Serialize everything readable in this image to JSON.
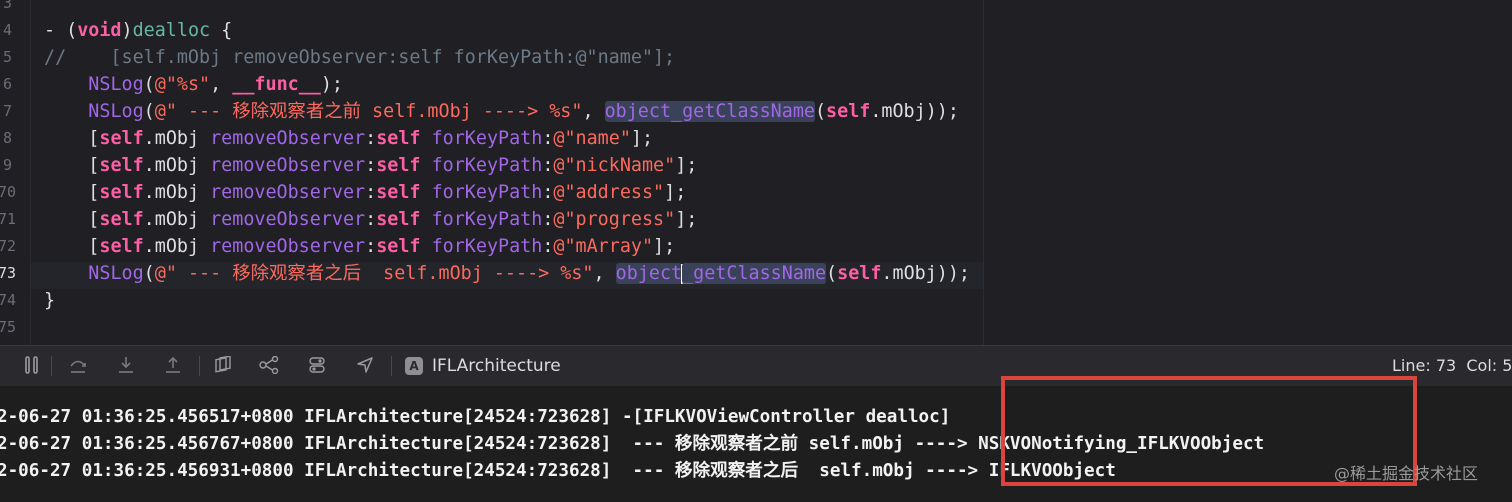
{
  "editor": {
    "line_numbers": [
      "3",
      "4",
      "5",
      "6",
      "7",
      "8",
      "9",
      "70",
      "71",
      "72",
      "73",
      "74",
      "75"
    ],
    "lines": [
      {
        "segments": [
          [
            "plain",
            "- ("
          ],
          [
            "kw",
            "void"
          ],
          [
            "plain",
            ")"
          ],
          [
            "fn2",
            "dealloc"
          ],
          [
            "plain",
            " {"
          ]
        ]
      },
      {
        "segments": [
          [
            "cm",
            "//    [self.mObj removeObserver:self forKeyPath:@\"name\"];"
          ]
        ]
      },
      {
        "segments": [
          [
            "plain",
            "    "
          ],
          [
            "fn",
            "NSLog"
          ],
          [
            "plain",
            "("
          ],
          [
            "str",
            "@\"%s\""
          ],
          [
            "plain",
            ", "
          ],
          [
            "kw",
            "__func__"
          ],
          [
            "plain",
            ");"
          ]
        ]
      },
      {
        "segments": [
          [
            "plain",
            "    "
          ],
          [
            "fn",
            "NSLog"
          ],
          [
            "plain",
            "("
          ],
          [
            "str",
            "@\" --- 移除观察者之前 self.mObj ----> %s\""
          ],
          [
            "plain",
            ", "
          ],
          [
            "fnhl",
            "object_getClassName"
          ],
          [
            "plain",
            "("
          ],
          [
            "kw",
            "self"
          ],
          [
            "plain",
            ".mObj));"
          ]
        ]
      },
      {
        "segments": [
          [
            "plain",
            "    ["
          ],
          [
            "kw",
            "self"
          ],
          [
            "plain",
            ".mObj "
          ],
          [
            "fn",
            "removeObserver"
          ],
          [
            "plain",
            ":"
          ],
          [
            "kw",
            "self"
          ],
          [
            "plain",
            " "
          ],
          [
            "fn",
            "forKeyPath"
          ],
          [
            "plain",
            ":"
          ],
          [
            "str",
            "@\"name\""
          ],
          [
            "plain",
            "];"
          ]
        ]
      },
      {
        "segments": [
          [
            "plain",
            "    ["
          ],
          [
            "kw",
            "self"
          ],
          [
            "plain",
            ".mObj "
          ],
          [
            "fn",
            "removeObserver"
          ],
          [
            "plain",
            ":"
          ],
          [
            "kw",
            "self"
          ],
          [
            "plain",
            " "
          ],
          [
            "fn",
            "forKeyPath"
          ],
          [
            "plain",
            ":"
          ],
          [
            "str",
            "@\"nickName\""
          ],
          [
            "plain",
            "];"
          ]
        ]
      },
      {
        "segments": [
          [
            "plain",
            "    ["
          ],
          [
            "kw",
            "self"
          ],
          [
            "plain",
            ".mObj "
          ],
          [
            "fn",
            "removeObserver"
          ],
          [
            "plain",
            ":"
          ],
          [
            "kw",
            "self"
          ],
          [
            "plain",
            " "
          ],
          [
            "fn",
            "forKeyPath"
          ],
          [
            "plain",
            ":"
          ],
          [
            "str",
            "@\"address\""
          ],
          [
            "plain",
            "];"
          ]
        ]
      },
      {
        "segments": [
          [
            "plain",
            "    ["
          ],
          [
            "kw",
            "self"
          ],
          [
            "plain",
            ".mObj "
          ],
          [
            "fn",
            "removeObserver"
          ],
          [
            "plain",
            ":"
          ],
          [
            "kw",
            "self"
          ],
          [
            "plain",
            " "
          ],
          [
            "fn",
            "forKeyPath"
          ],
          [
            "plain",
            ":"
          ],
          [
            "str",
            "@\"progress\""
          ],
          [
            "plain",
            "];"
          ]
        ]
      },
      {
        "segments": [
          [
            "plain",
            "    ["
          ],
          [
            "kw",
            "self"
          ],
          [
            "plain",
            ".mObj "
          ],
          [
            "fn",
            "removeObserver"
          ],
          [
            "plain",
            ":"
          ],
          [
            "kw",
            "self"
          ],
          [
            "plain",
            " "
          ],
          [
            "fn",
            "forKeyPath"
          ],
          [
            "plain",
            ":"
          ],
          [
            "str",
            "@\"mArray\""
          ],
          [
            "plain",
            "];"
          ]
        ]
      },
      {
        "segments": [
          [
            "plain",
            "    "
          ],
          [
            "fn",
            "NSLog"
          ],
          [
            "plain",
            "("
          ],
          [
            "str",
            "@\" --- 移除观察者之后  self.mObj ----> %s\""
          ],
          [
            "plain",
            ", "
          ],
          [
            "fnhl",
            "object"
          ],
          [
            "cursor",
            ""
          ],
          [
            "fnhl",
            "_getClassName"
          ],
          [
            "plain",
            "("
          ],
          [
            "kw",
            "self"
          ],
          [
            "plain",
            ".mObj));"
          ]
        ]
      },
      {
        "segments": [
          [
            "plain",
            "}"
          ]
        ]
      }
    ],
    "active_line": "73"
  },
  "toolbar": {
    "scheme_label": "IFLArchitecture",
    "scheme_icon": "A",
    "line_col": "Line: 73  Col: 5",
    "icons": [
      "pause-icon",
      "step-over-icon",
      "step-into-icon",
      "step-out-icon",
      "view-hierarchy-icon",
      "memory-graph-icon",
      "environment-icon",
      "location-icon"
    ]
  },
  "console": {
    "lines": [
      "2-06-27 01:36:25.456517+0800 IFLArchitecture[24524:723628] -[IFLKVOViewController dealloc]",
      "2-06-27 01:36:25.456767+0800 IFLArchitecture[24524:723628]  --- 移除观察者之前 self.mObj ----> NSKVONotifying_IFLKVOObject",
      "2-06-27 01:36:25.456931+0800 IFLArchitecture[24524:723628]  --- 移除观察者之后  self.mObj ----> IFLKVOObject"
    ]
  },
  "watermark": "@稀土掘金技术社区",
  "colors": {
    "keyword": "#fc5fa3",
    "function": "#a167e6",
    "string": "#fc6a5d",
    "comment": "#6c7986",
    "highlight_box": "#d9453c"
  }
}
